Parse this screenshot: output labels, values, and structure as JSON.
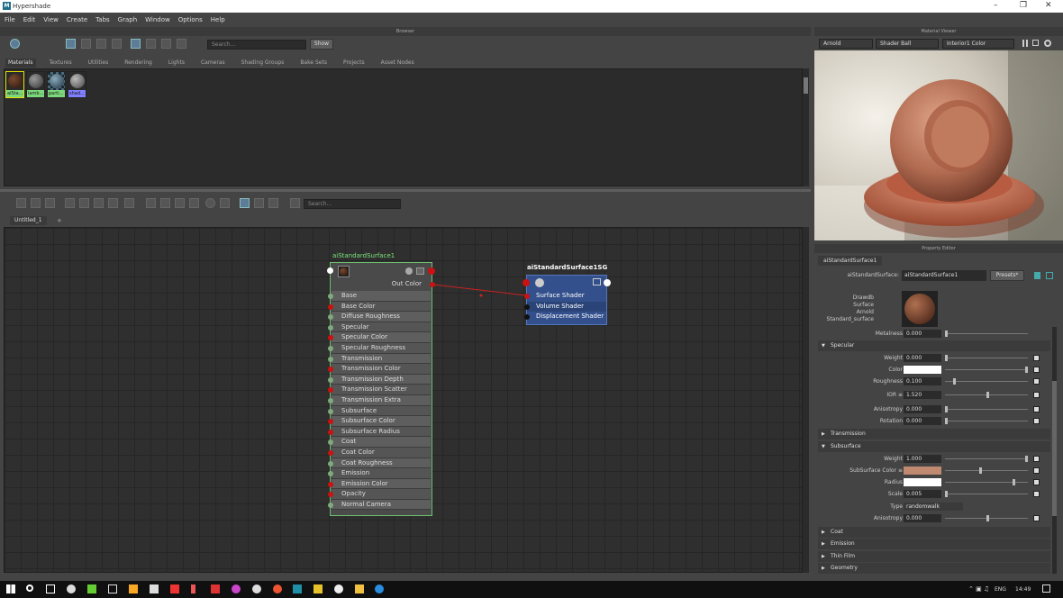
{
  "window": {
    "title": "Hypershade"
  },
  "menubar": [
    "File",
    "Edit",
    "View",
    "Create",
    "Tabs",
    "Graph",
    "Window",
    "Options",
    "Help"
  ],
  "browser": {
    "panel_title": "Browser",
    "search_placeholder": "Search...",
    "show_label": "Show",
    "tabs": [
      "Materials",
      "Textures",
      "Utilities",
      "Rendering",
      "Lights",
      "Cameras",
      "Shading Groups",
      "Bake Sets",
      "Projects",
      "Asset Nodes"
    ],
    "swatches": [
      {
        "label": "aiSta...",
        "color": "#3a1f14",
        "tag": "#7dd87d"
      },
      {
        "label": "lamb...",
        "color": "#555555",
        "tag": "#7dd87d"
      },
      {
        "label": "parti...",
        "color": "#4a6a7a",
        "tag": "#7dd87d"
      },
      {
        "label": "shad...",
        "color": "#777777",
        "tag": "#8080ff"
      }
    ]
  },
  "graph": {
    "search_placeholder": "Search...",
    "tab_label": "Untitled_1",
    "add_tab": "+",
    "surface_node": {
      "title": "aiStandardSurface1",
      "out_label": "Out Color",
      "attributes": [
        "Base",
        "Base Color",
        "Diffuse Roughness",
        "Specular",
        "Specular Color",
        "Specular Roughness",
        "Transmission",
        "Transmission Color",
        "Transmission Depth",
        "Transmission Scatter",
        "Transmission Extra Roughness",
        "Subsurface",
        "Subsurface Color",
        "Subsurface Radius",
        "Coat",
        "Coat Color",
        "Coat Roughness",
        "Emission",
        "Emission Color",
        "Opacity",
        "Normal Camera"
      ]
    },
    "sg_node": {
      "title": "aiStandardSurface1SG",
      "attributes": [
        "Surface Shader",
        "Volume Shader",
        "Displacement Shader"
      ]
    }
  },
  "material_viewer": {
    "panel_title": "Material Viewer",
    "renderer": "Arnold",
    "shape": "Shader Ball",
    "environment": "Interior1 Color"
  },
  "property_editor": {
    "panel_title": "Property Editor",
    "tab": "aiStandardSurface1",
    "node_label": "aiStandardSurface:",
    "node_name": "aiStandardSurface1",
    "presets_label": "Presets*",
    "classification": [
      "Drawdb",
      "Surface",
      "Arnold",
      "Standard_surface"
    ],
    "metalness": {
      "label": "Metalness",
      "value": "0.000"
    },
    "specular": {
      "header": "Specular",
      "weight": {
        "label": "Weight",
        "value": "0.000"
      },
      "color": {
        "label": "Color",
        "swatch": "#ffffff"
      },
      "roughness": {
        "label": "Roughness",
        "value": "0.100"
      },
      "ior": {
        "label": "IOR ≡",
        "value": "1.520"
      },
      "anisotropy": {
        "label": "Anisotropy",
        "value": "0.000"
      },
      "rotation": {
        "label": "Rotation",
        "value": "0.000"
      }
    },
    "transmission": {
      "header": "Transmission"
    },
    "subsurface": {
      "header": "Subsurface",
      "weight": {
        "label": "Weight",
        "value": "1.000"
      },
      "color": {
        "label": "SubSurface Color ≡",
        "swatch": "#c08a70"
      },
      "radius": {
        "label": "Radius",
        "swatch": "#ffffff"
      },
      "scale": {
        "label": "Scale",
        "value": "0.005"
      },
      "type": {
        "label": "Type",
        "value": "randomwalk"
      },
      "anisotropy": {
        "label": "Anisotropy",
        "value": "0.000"
      }
    },
    "collapsed_sections": [
      "Coat",
      "Emission",
      "Thin Film",
      "Geometry"
    ]
  },
  "taskbar": {
    "language": "ENG",
    "time": "14:49"
  },
  "colors": {
    "accent": "#5d7c98",
    "sg_node": "#33508c",
    "surface_border": "#6fbf6f",
    "connection": "#cc2222"
  }
}
